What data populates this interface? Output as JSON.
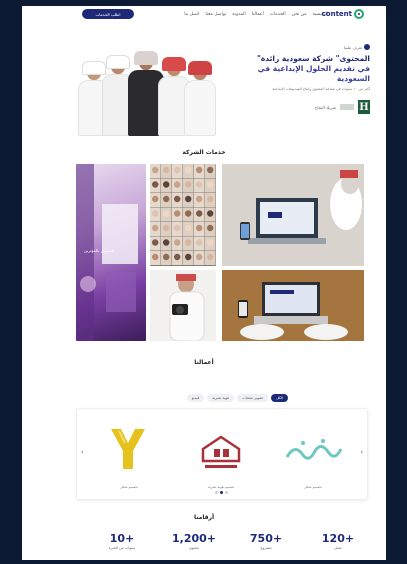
{
  "header": {
    "logo_text": "content",
    "cta_label": "اطلب الخدمات",
    "nav": [
      "الرئيسية",
      "من نحن",
      "الخدمات",
      "أعمالنا",
      "المدونة",
      "تواصل معنا",
      "اتصل بنا"
    ]
  },
  "hero": {
    "kicker": "تعرف علينا",
    "title_line1": "\"المحتوى\" شركة سعودية رائدة",
    "title_line2": "في تقديم الحلول الإبداعية في السعودية",
    "subtitle": "أكثر من ١٠ سنوات في صناعة المحتوى وإنتاج الفيديوهات الإبداعية",
    "partner_label": "شريك النجاح",
    "partner_mark": "H"
  },
  "services": {
    "title": "خدمات الشركة",
    "tile1_caption": "التسويق بالمؤثرين"
  },
  "work": {
    "title": "أعمالنا",
    "filters": [
      "الكل",
      "تصوير منتجات",
      "هوية بصرية",
      "فيديو"
    ],
    "items": [
      {
        "caption": "تصميم شعار"
      },
      {
        "caption": "تصميم هوية بصرية"
      },
      {
        "caption": "تصميم شعار"
      }
    ],
    "prev": "‹",
    "next": "›"
  },
  "stats": {
    "title": "أرقامنا",
    "items": [
      {
        "num": "120+",
        "label": "عميل"
      },
      {
        "num": "750+",
        "label": "مشروع"
      },
      {
        "num": "1,200+",
        "label": "محتوى"
      },
      {
        "num": "10+",
        "label": "سنوات من الخبرة"
      }
    ]
  },
  "colors": {
    "primary": "#1e2a78",
    "accent": "#25a86b"
  }
}
